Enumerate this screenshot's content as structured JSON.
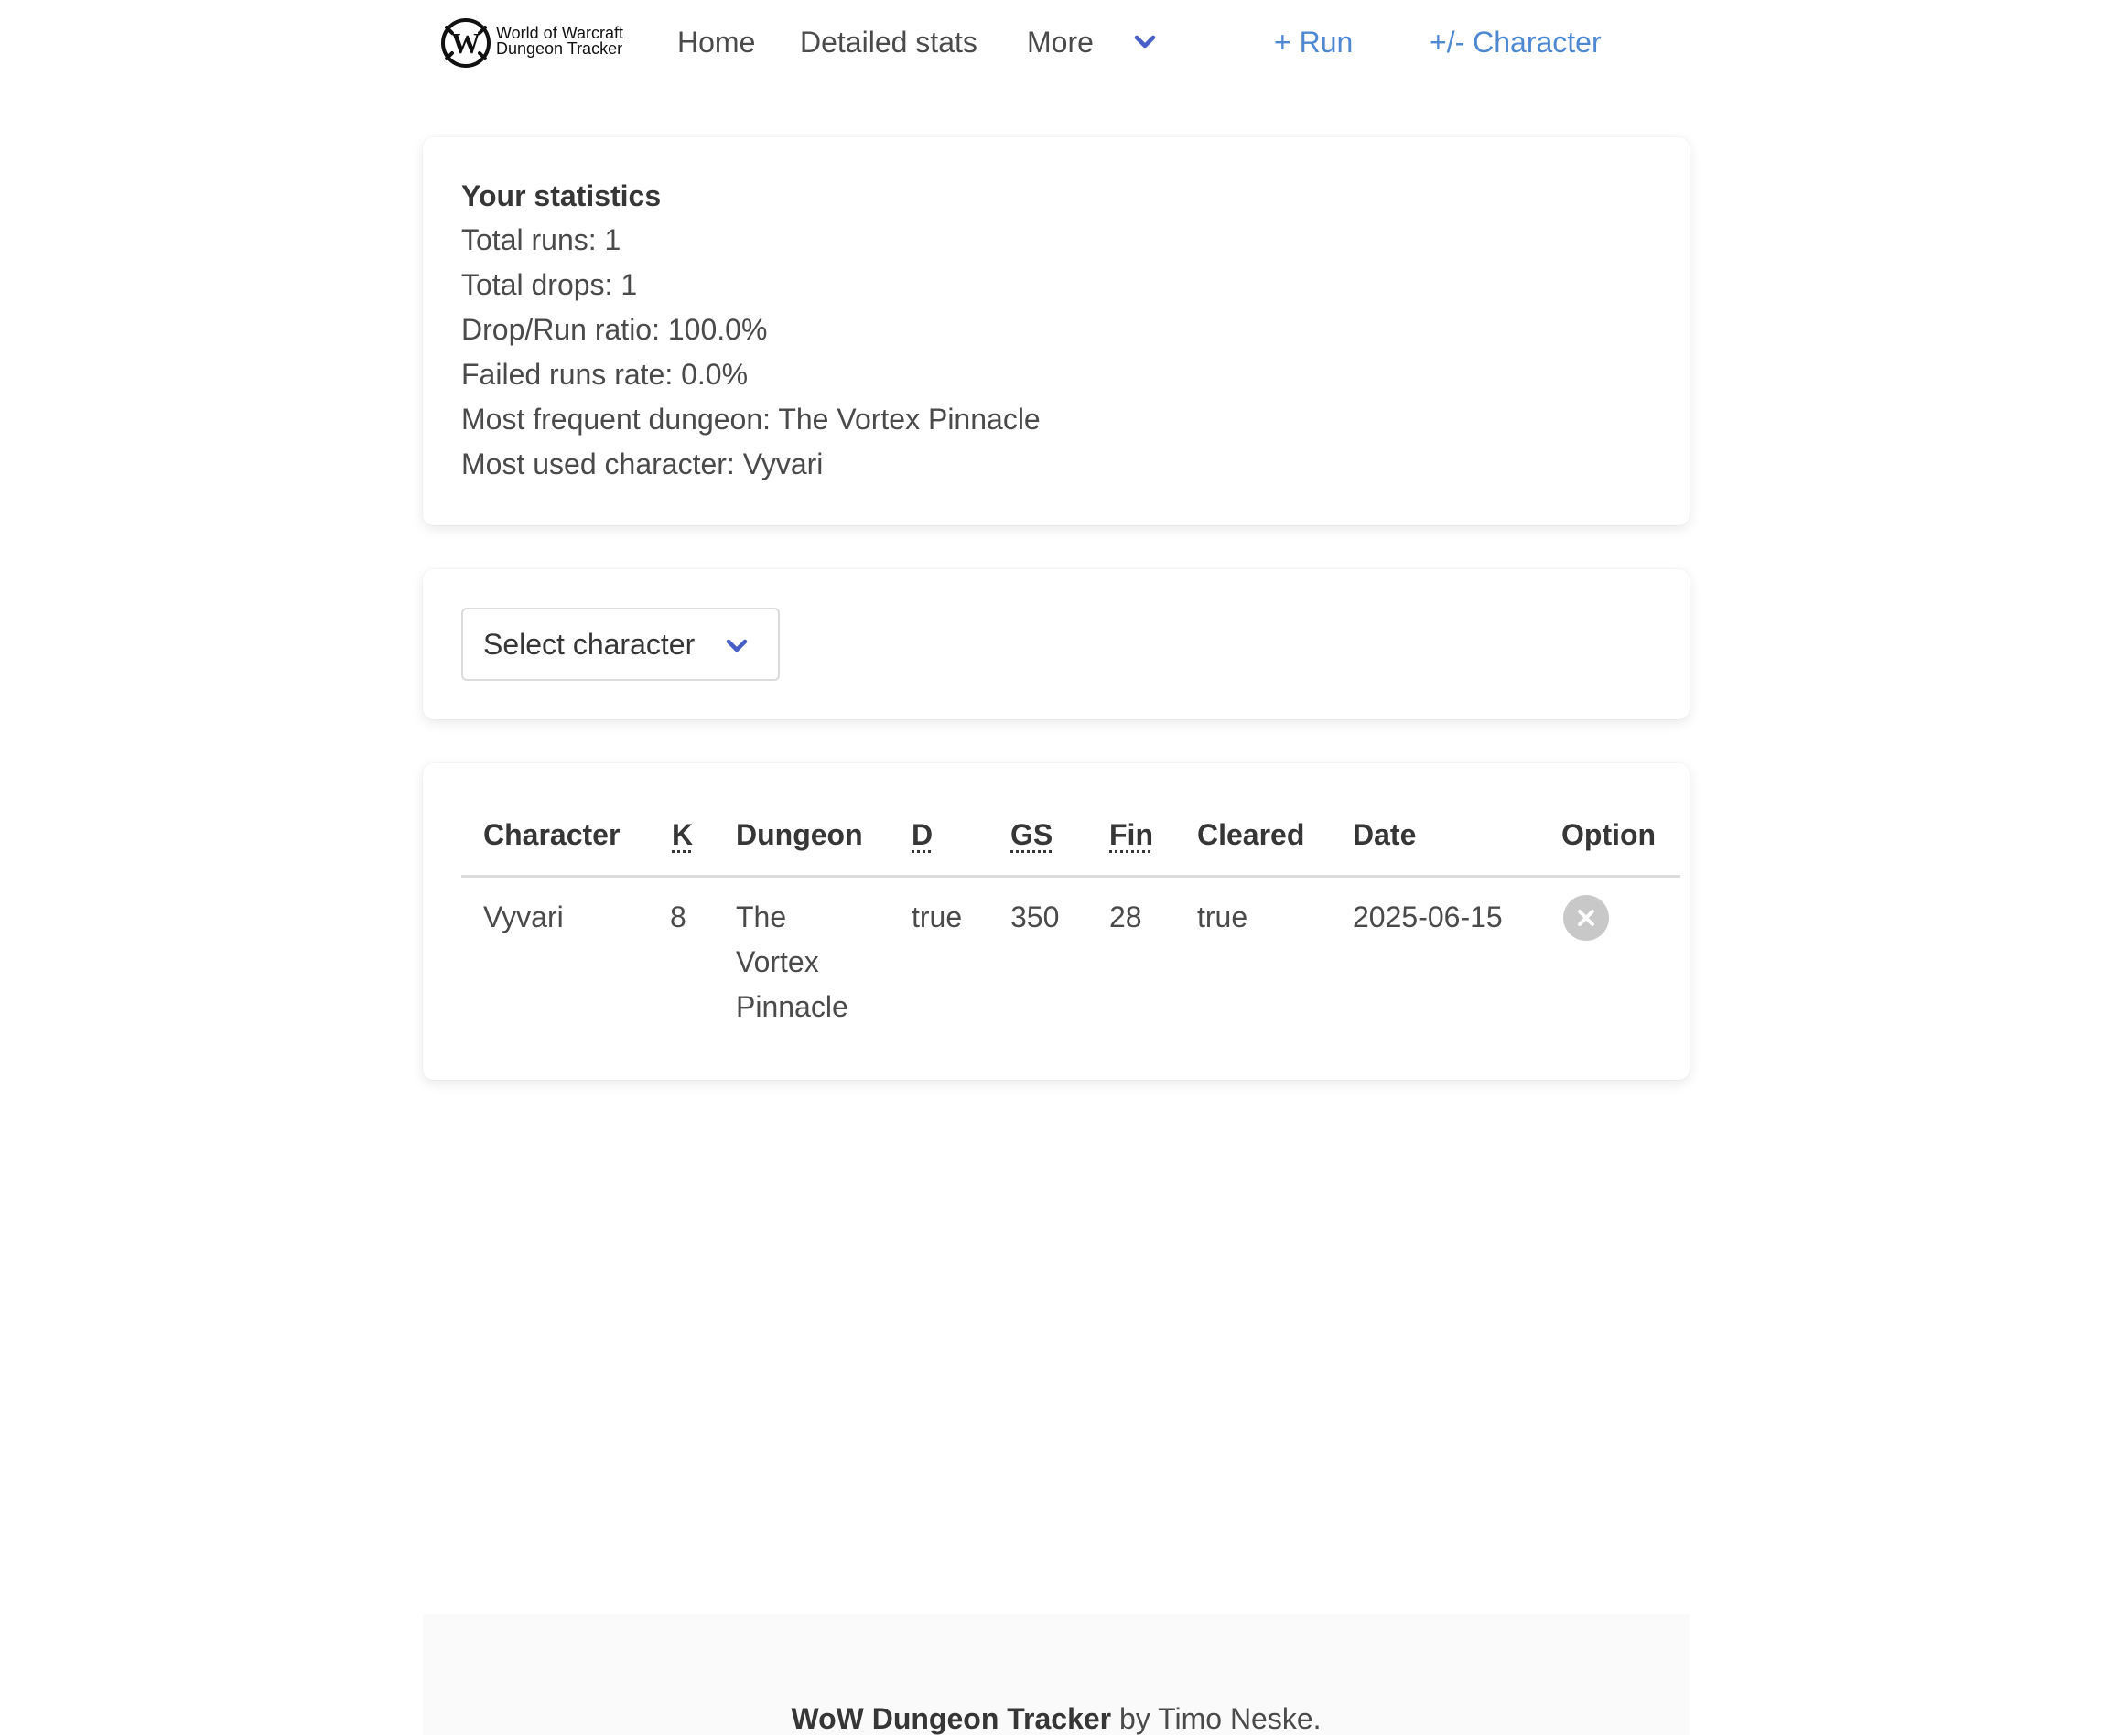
{
  "navbar": {
    "brand": {
      "line1": "World of Warcraft",
      "line2": "Dungeon Tracker",
      "logo_letter": "W"
    },
    "home": "Home",
    "detailed_stats": "Detailed stats",
    "more": "More",
    "add_run": "+ Run",
    "character": "+/- Character",
    "icons": {
      "more": "chevron-down-icon"
    },
    "link_color": "#4d88d0",
    "accent_color": "#485fc7"
  },
  "stats": {
    "title": "Your statistics",
    "lines": [
      "Total runs: 1",
      "Total drops: 1",
      "Drop/Run ratio: 100.0%",
      "Failed runs rate: 0.0%",
      "Most frequent dungeon: The Vortex Pinnacle",
      "Most used character: Vyvari"
    ]
  },
  "character_select": {
    "label": "Select character",
    "icon": "chevron-down-icon"
  },
  "runs_table": {
    "columns": [
      "Character",
      "K",
      "Dungeon",
      "D",
      "GS",
      "Fin",
      "Cleared",
      "Date",
      "Option"
    ],
    "rows": [
      {
        "character": "Vyvari",
        "k": "8",
        "dungeon_lines": [
          "The",
          "Vortex",
          "Pinnacle"
        ],
        "d": "true",
        "gs": "350",
        "fin": "28",
        "cleared": "true",
        "date": "2025-06-15",
        "option_icon": "close-circle-icon"
      }
    ]
  },
  "footer": {
    "app_name": "WoW Dungeon Tracker",
    "byline": " by Timo Neske."
  }
}
